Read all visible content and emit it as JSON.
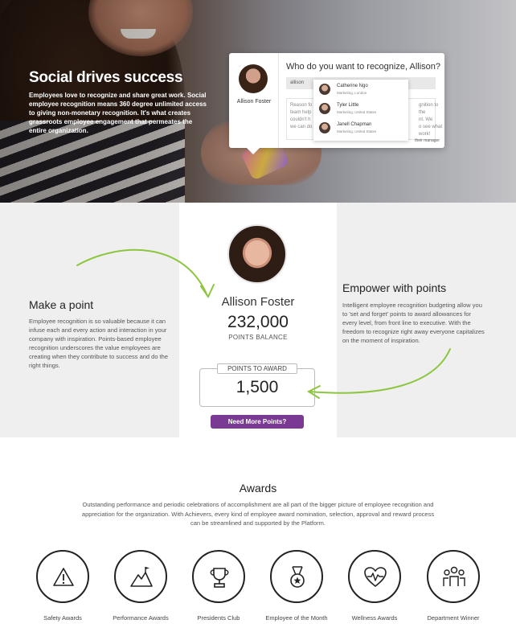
{
  "hero": {
    "title": "Social drives success",
    "text": "Employees love to recognize and share great work. Social employee recognition means 360 degree unlimited access to giving non-monetary recognition. It's what creates grassroots employee engagement that permeates the entire organization."
  },
  "recognize_card": {
    "user_name": "Allison Foster",
    "question": "Who do you want to recognize, Allison?",
    "search_value": "allison",
    "reason_text_left": "Reason fo\nteam help\ncouldn't h\nwe can do",
    "reason_text_right": "gnition to the\nnt. We\no see what\nwork!",
    "manager_text": "their manager",
    "suggestions": [
      {
        "name": "Catherine Ngo",
        "location": "Marketing, London"
      },
      {
        "name": "Tyler Little",
        "location": "Marketing, United States"
      },
      {
        "name": "Janell Chapman",
        "location": "Marketing, United States"
      }
    ]
  },
  "points": {
    "make_point_title": "Make a point",
    "make_point_text": "Employee recognition is so valuable because it can infuse each and every action and interaction in your company with inspiration. Points-based employee recognition underscores the value employees are creating when they contribute to success and do the right things.",
    "empower_title": "Empower with points",
    "empower_text": "Intelligent employee recognition budgeting allow you to 'set and forget' points to award allowances for every level, from front line to executive. With the freedom to recognize right away everyone capitalizes on the moment of inspiration.",
    "profile_name": "Allison Foster",
    "balance": "232,000",
    "balance_label": "POINTS BALANCE",
    "award_label": "POINTS TO AWARD",
    "award_value": "1,500",
    "button_label": "Need More Points?",
    "accent_color": "#7a3a93",
    "arrow_color": "#8cc63f"
  },
  "awards": {
    "title": "Awards",
    "text": "Outstanding performance and periodic celebrations of accomplishment are all part of the bigger picture of employee recognition and appreciation for the organization. With Achievers, every kind of employee award nomination, selection, approval and reward process can be streamlined and supported by the Platform.",
    "items": [
      {
        "label": "Safety Awards",
        "icon": "warning-icon"
      },
      {
        "label": "Performance Awards",
        "icon": "mountain-flag-icon"
      },
      {
        "label": "Presidents Club",
        "icon": "trophy-icon"
      },
      {
        "label": "Employee of the Month",
        "icon": "medal-icon"
      },
      {
        "label": "Wellness Awards",
        "icon": "heartbeat-icon"
      },
      {
        "label": "Department Winner",
        "icon": "team-icon"
      }
    ]
  }
}
